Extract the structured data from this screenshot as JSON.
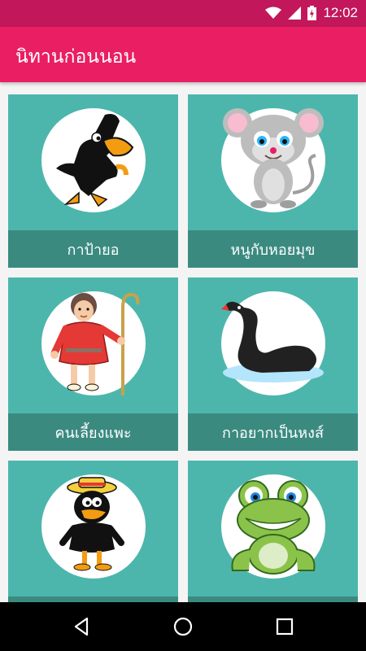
{
  "status_bar": {
    "time": "12:02",
    "icons": [
      "wifi-icon",
      "signal-icon",
      "battery-charging-icon"
    ]
  },
  "app_bar": {
    "title": "นิทานก่อนนอน"
  },
  "stories": [
    {
      "title": "กาป้ายอ",
      "icon": "crow-icon"
    },
    {
      "title": "หนูกับหอยมุข",
      "icon": "mouse-icon"
    },
    {
      "title": "คนเลี้ยงแพะ",
      "icon": "shepherd-icon"
    },
    {
      "title": "กาอยากเป็นหงส์",
      "icon": "swan-icon"
    },
    {
      "title": "",
      "icon": "crow-with-hat-icon"
    },
    {
      "title": "",
      "icon": "frog-icon"
    }
  ],
  "nav_bar": {
    "buttons": [
      "back-icon",
      "home-icon",
      "recents-icon"
    ]
  },
  "colors": {
    "status_bar": "#c2185b",
    "app_bar": "#e91e63",
    "card": "#4db6ac",
    "caption": "#3b8a80"
  }
}
